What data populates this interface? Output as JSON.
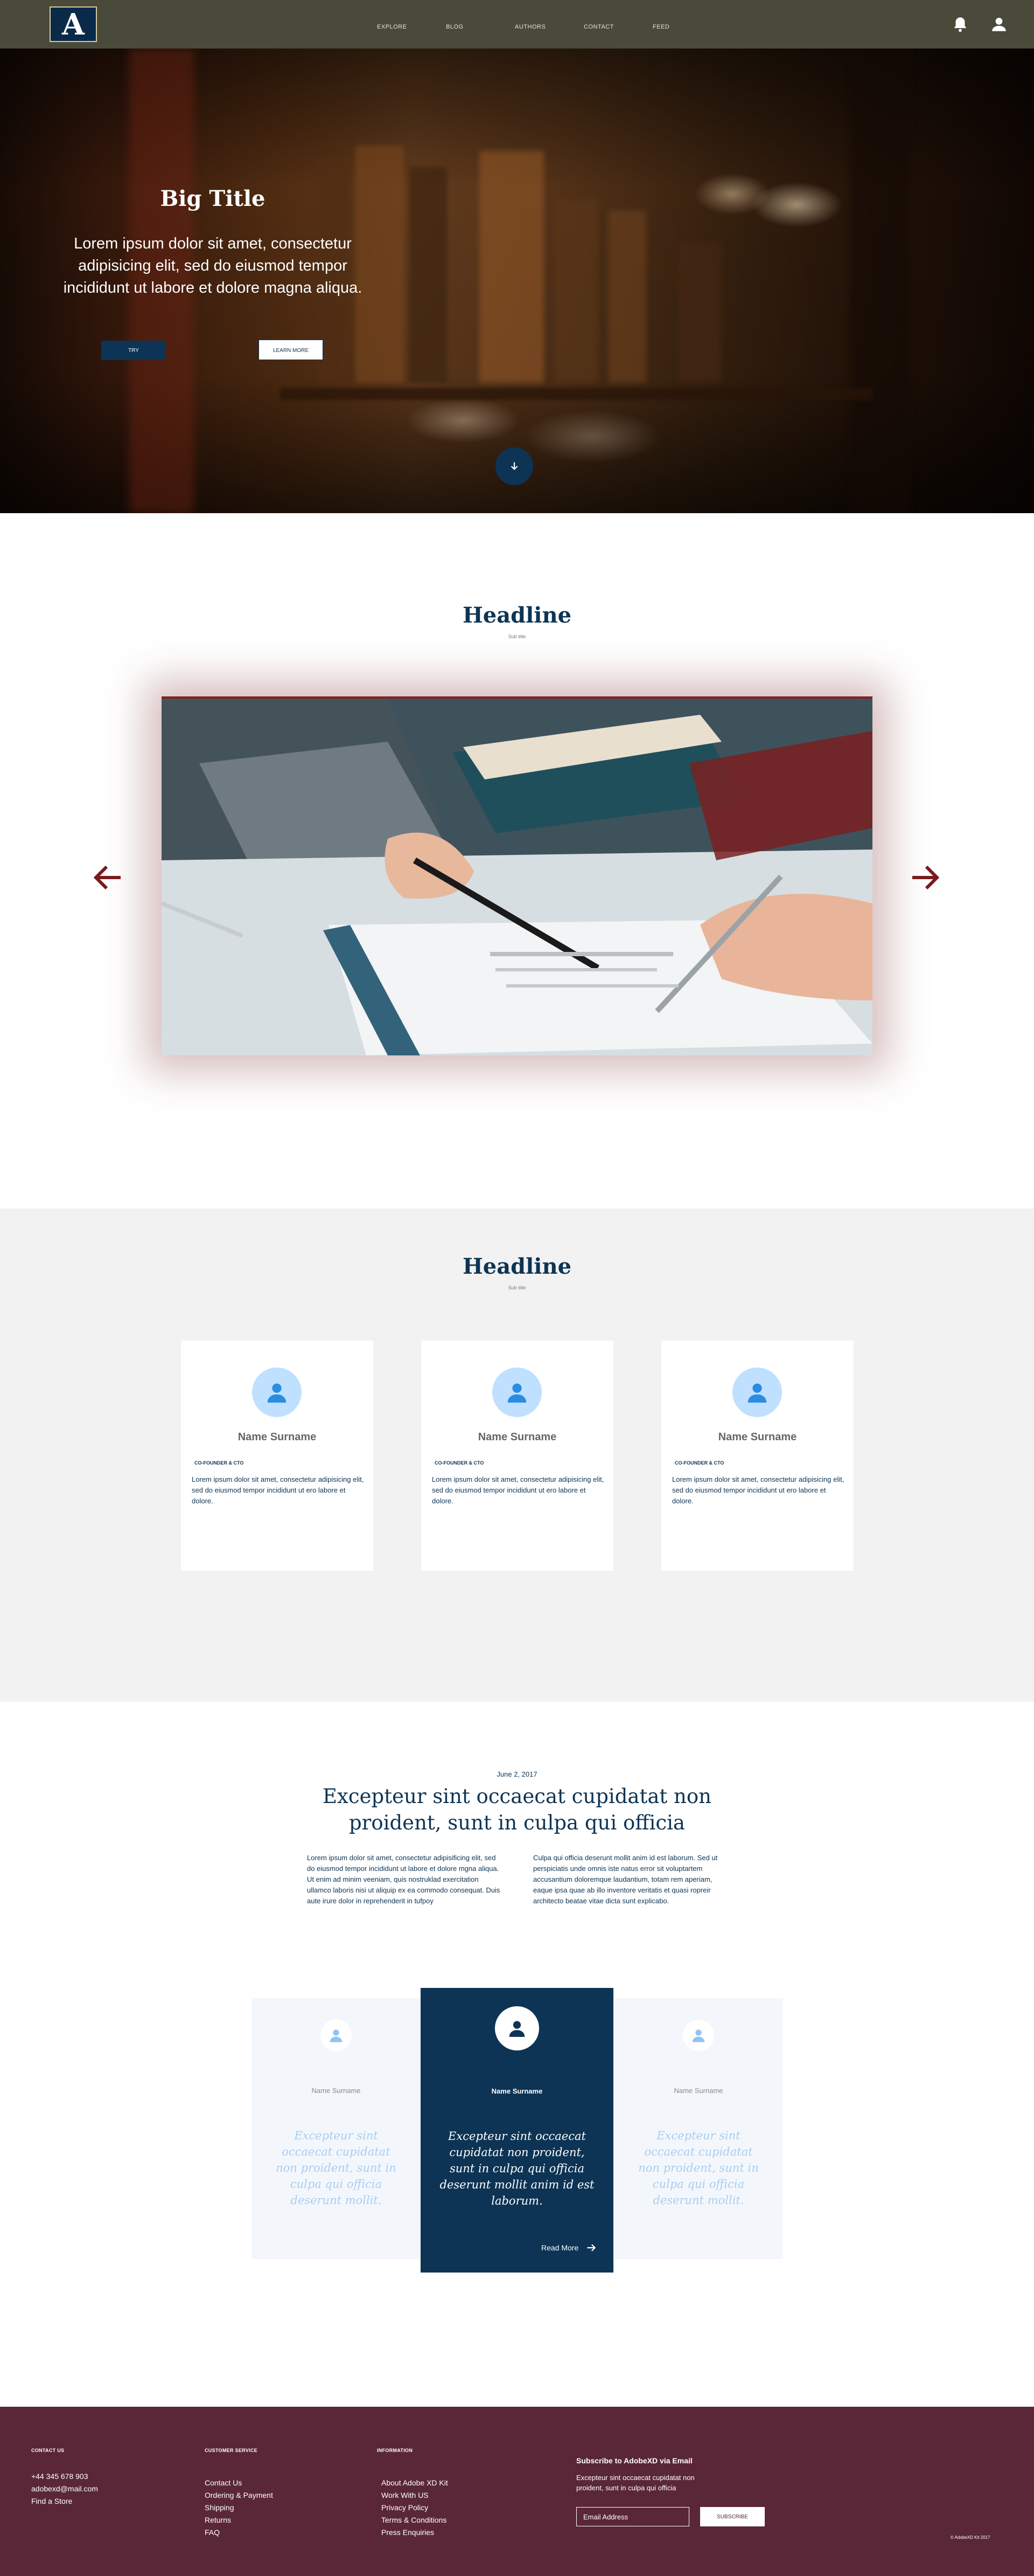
{
  "nav": {
    "logo_letter": "A",
    "links": [
      "EXPLORE",
      "BLOG",
      "AUTHORS",
      "CONTACT",
      "FEED"
    ]
  },
  "hero": {
    "title": "Big Title",
    "subtitle": "Lorem ipsum dolor sit amet, consectetur adipisicing elit, sed do eiusmod tempor incididunt ut labore et dolore magna aliqua.",
    "try_label": "TRY",
    "learn_label": "LEARN MORE"
  },
  "carousel_section": {
    "headline": "Headline",
    "subline": "Sub title"
  },
  "team": {
    "headline": "Headline",
    "subline": "Sub title",
    "members": [
      {
        "name": "Name Surname",
        "role": "CO-FOUNDER & CTO",
        "bio": "Lorem ipsum dolor sit amet, consectetur adipisicing elit, sed do eiusmod tempor incididunt ut ero labore et dolore."
      },
      {
        "name": "Name Surname",
        "role": "CO-FOUNDER & CTO",
        "bio": "Lorem ipsum dolor sit amet, consectetur adipisicing elit, sed do eiusmod tempor incididunt ut ero labore et dolore."
      },
      {
        "name": "Name Surname",
        "role": "CO-FOUNDER & CTO",
        "bio": "Lorem ipsum dolor sit amet, consectetur adipisicing elit, sed do eiusmod tempor incididunt ut ero labore et dolore."
      }
    ]
  },
  "article": {
    "date": "June 2, 2017",
    "title": "Excepteur sint occaecat cupidatat non proident, sunt in culpa qui officia",
    "col1": "Lorem ipsum dolor sit amet, consectetur adipisificing elit, sed do eiusmod tempor incididunt ut labore et dolore mgna aliqua. Ut enim ad minim veeniam, quis nostruklad exercitation ullamco laboris nisi ut aliquip ex ea commodo consequat. Duis aute irure dolor in reprehenderit in tufpoy",
    "col2": "Culpa qui officia deserunt mollit anim id est laborum. Sed ut perspiciatis unde omnis iste natus error sit voluptartem accusantium doloremque laudantium, totam rem aperiam, eaque ipsa quae ab illo inventore veritatis et quasi ropreir architecto beatae vitae dicta sunt explicabo."
  },
  "testimonials": [
    {
      "name": "Name Surname",
      "quote": "Excepteur sint occaecat cupidatat non proident, sunt in culpa qui officia deserunt mollit."
    },
    {
      "name": "Name Surname",
      "quote": "Excepteur sint occaecat cupidatat non proident, sunt in culpa qui officia deserunt mollit anim id est laborum.",
      "read_more": "Read More"
    },
    {
      "name": "Name Surname",
      "quote": "Excepteur sint occaecat cupidatat non proident, sunt in culpa qui officia deserunt mollit."
    }
  ],
  "footer": {
    "contact_head": "CONTACT US",
    "contact": [
      "+44 345 678 903",
      "adobexd@mail.com",
      "Find a Store"
    ],
    "service_head": "CUSTOMER SERVICE",
    "service": [
      "Contact Us",
      "Ordering & Payment",
      "Shipping",
      "Returns",
      "FAQ"
    ],
    "info_head": "INFORMATION",
    "info": [
      "About Adobe XD Kit",
      "Work With US",
      "Privacy Policy",
      "Terms & Conditions",
      "Press Enquiries"
    ],
    "subscribe_head": "Subscribe to AdobeXD via Email",
    "subscribe_text": "Excepteur sint occaecat cupidatat non proident, sunt in culpa qui officia",
    "email_placeholder": "Email Address",
    "subscribe_label": "SUBSCRIBE",
    "copyright": "© AdobeXD Kit 2017"
  },
  "colors": {
    "navy": "#0d3454",
    "footer": "#5a2738",
    "carousel_arrow": "#7a1a1a",
    "avatar_light": "#bfe0ff"
  }
}
